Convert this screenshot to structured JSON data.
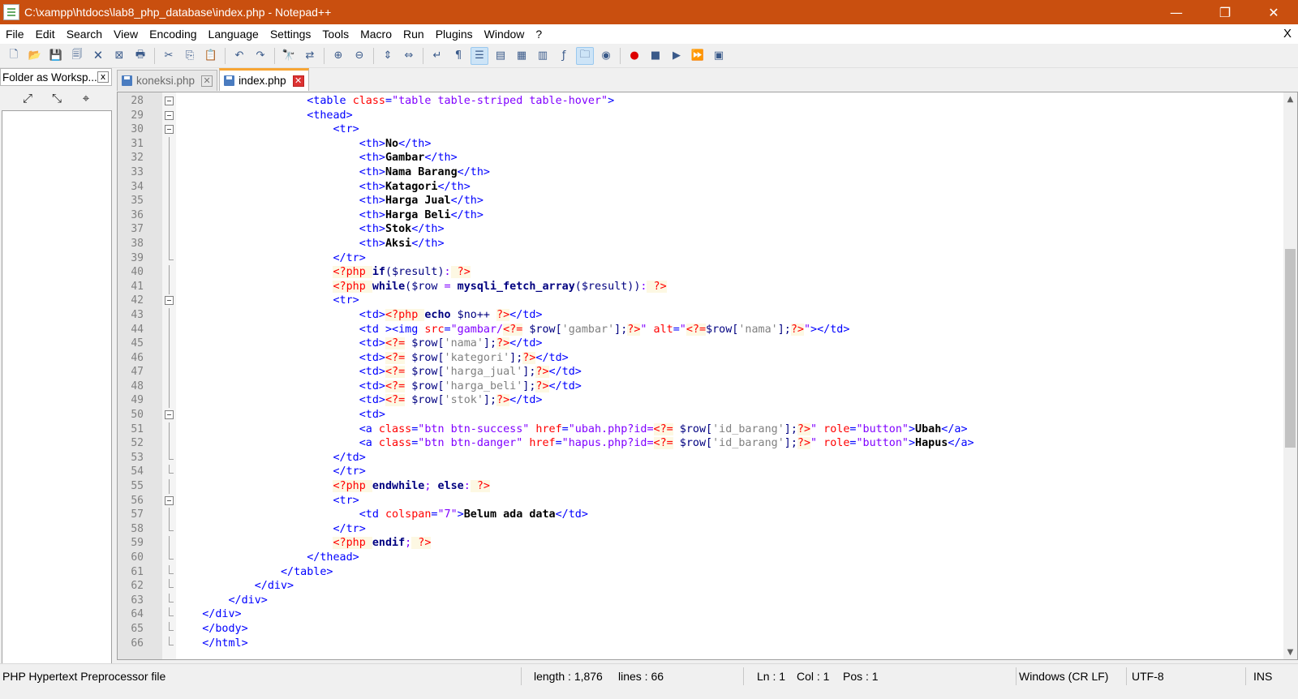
{
  "window": {
    "title": "C:\\xampp\\htdocs\\lab8_php_database\\index.php - Notepad++",
    "minimize": "—",
    "restore": "❐",
    "close": "✕"
  },
  "menu": [
    "File",
    "Edit",
    "Search",
    "View",
    "Encoding",
    "Language",
    "Settings",
    "Tools",
    "Macro",
    "Run",
    "Plugins",
    "Window",
    "?"
  ],
  "menu_close": "X",
  "panel": {
    "title": "Folder as Worksp...",
    "close": "x"
  },
  "tabs": [
    {
      "label": "koneksi.php",
      "close": "✕"
    },
    {
      "label": "index.php",
      "close": "✕"
    }
  ],
  "editor": {
    "lines": [
      {
        "n": "28",
        "fold": "box"
      },
      {
        "n": "29",
        "fold": "box"
      },
      {
        "n": "30",
        "fold": "box"
      },
      {
        "n": "31",
        "fold": "mid"
      },
      {
        "n": "32",
        "fold": "mid"
      },
      {
        "n": "33",
        "fold": "mid"
      },
      {
        "n": "34",
        "fold": "mid"
      },
      {
        "n": "35",
        "fold": "mid"
      },
      {
        "n": "36",
        "fold": "mid"
      },
      {
        "n": "37",
        "fold": "mid"
      },
      {
        "n": "38",
        "fold": "mid"
      },
      {
        "n": "39",
        "fold": "end"
      },
      {
        "n": "40",
        "fold": "mid"
      },
      {
        "n": "41",
        "fold": "mid"
      },
      {
        "n": "42",
        "fold": "box"
      },
      {
        "n": "43",
        "fold": "mid"
      },
      {
        "n": "44",
        "fold": "mid"
      },
      {
        "n": "45",
        "fold": "mid"
      },
      {
        "n": "46",
        "fold": "mid"
      },
      {
        "n": "47",
        "fold": "mid"
      },
      {
        "n": "48",
        "fold": "mid"
      },
      {
        "n": "49",
        "fold": "mid"
      },
      {
        "n": "50",
        "fold": "box"
      },
      {
        "n": "51",
        "fold": "mid"
      },
      {
        "n": "52",
        "fold": "mid"
      },
      {
        "n": "53",
        "fold": "end"
      },
      {
        "n": "54",
        "fold": "end"
      },
      {
        "n": "55",
        "fold": "mid"
      },
      {
        "n": "56",
        "fold": "box"
      },
      {
        "n": "57",
        "fold": "mid"
      },
      {
        "n": "58",
        "fold": "end"
      },
      {
        "n": "59",
        "fold": "mid"
      },
      {
        "n": "60",
        "fold": "end"
      },
      {
        "n": "61",
        "fold": "end"
      },
      {
        "n": "62",
        "fold": "end"
      },
      {
        "n": "63",
        "fold": "end"
      },
      {
        "n": "64",
        "fold": "end"
      },
      {
        "n": "65",
        "fold": "end"
      },
      {
        "n": "66",
        "fold": "end"
      }
    ],
    "code": [
      [
        [
          "",
          "                    "
        ],
        [
          "t",
          "<table "
        ],
        [
          "a",
          "class"
        ],
        [
          "t",
          "="
        ],
        [
          "v",
          "\"table table-striped table-hover\""
        ],
        [
          "t",
          ">"
        ]
      ],
      [
        [
          "",
          "                    "
        ],
        [
          "t",
          "<thead>"
        ]
      ],
      [
        [
          "",
          "                        "
        ],
        [
          "t",
          "<tr>"
        ]
      ],
      [
        [
          "",
          "                            "
        ],
        [
          "t",
          "<th>"
        ],
        [
          "b",
          "No"
        ],
        [
          "t",
          "</th>"
        ]
      ],
      [
        [
          "",
          "                            "
        ],
        [
          "t",
          "<th>"
        ],
        [
          "b",
          "Gambar"
        ],
        [
          "t",
          "</th>"
        ]
      ],
      [
        [
          "",
          "                            "
        ],
        [
          "t",
          "<th>"
        ],
        [
          "b",
          "Nama Barang"
        ],
        [
          "t",
          "</th>"
        ]
      ],
      [
        [
          "",
          "                            "
        ],
        [
          "t",
          "<th>"
        ],
        [
          "b",
          "Katagori"
        ],
        [
          "t",
          "</th>"
        ]
      ],
      [
        [
          "",
          "                            "
        ],
        [
          "t",
          "<th>"
        ],
        [
          "b",
          "Harga Jual"
        ],
        [
          "t",
          "</th>"
        ]
      ],
      [
        [
          "",
          "                            "
        ],
        [
          "t",
          "<th>"
        ],
        [
          "b",
          "Harga Beli"
        ],
        [
          "t",
          "</th>"
        ]
      ],
      [
        [
          "",
          "                            "
        ],
        [
          "t",
          "<th>"
        ],
        [
          "b",
          "Stok"
        ],
        [
          "t",
          "</th>"
        ]
      ],
      [
        [
          "",
          "                            "
        ],
        [
          "t",
          "<th>"
        ],
        [
          "b",
          "Aksi"
        ],
        [
          "t",
          "</th>"
        ]
      ],
      [
        [
          "",
          "                        "
        ],
        [
          "t",
          "</tr>"
        ]
      ],
      [
        [
          "",
          "                        "
        ],
        [
          "php",
          "<?php "
        ],
        [
          "kw",
          "if"
        ],
        [
          "pv",
          "($result)"
        ],
        [
          "op",
          ":"
        ],
        [
          "php",
          " ?>"
        ]
      ],
      [
        [
          "",
          "                        "
        ],
        [
          "php",
          "<?php "
        ],
        [
          "kw",
          "while"
        ],
        [
          "pv",
          "($row "
        ],
        [
          "op",
          "="
        ],
        [
          "pv",
          " "
        ],
        [
          "kw",
          "mysqli_fetch_array"
        ],
        [
          "pv",
          "($result))"
        ],
        [
          "op",
          ":"
        ],
        [
          "php",
          " ?>"
        ]
      ],
      [
        [
          "",
          "                        "
        ],
        [
          "t",
          "<tr>"
        ]
      ],
      [
        [
          "",
          "                            "
        ],
        [
          "t",
          "<td>"
        ],
        [
          "php",
          "<?php "
        ],
        [
          "kw",
          "echo"
        ],
        [
          "pv",
          " $no++ "
        ],
        [
          "php",
          "?>"
        ],
        [
          "t",
          "</td>"
        ]
      ],
      [
        [
          "",
          "                            "
        ],
        [
          "t",
          "<td ><img "
        ],
        [
          "a",
          "src"
        ],
        [
          "t",
          "="
        ],
        [
          "v",
          "\"gambar/"
        ],
        [
          "php",
          "<?="
        ],
        [
          "pv",
          " $row["
        ],
        [
          "str",
          "'gambar'"
        ],
        [
          "pv",
          "];"
        ],
        [
          "php",
          "?>"
        ],
        [
          "v",
          "\""
        ],
        [
          "a",
          " alt"
        ],
        [
          "t",
          "="
        ],
        [
          "v",
          "\""
        ],
        [
          "php",
          "<?="
        ],
        [
          "pv",
          "$row["
        ],
        [
          "str",
          "'nama'"
        ],
        [
          "pv",
          "];"
        ],
        [
          "php",
          "?>"
        ],
        [
          "v",
          "\""
        ],
        [
          "t",
          "></td>"
        ]
      ],
      [
        [
          "",
          "                            "
        ],
        [
          "t",
          "<td>"
        ],
        [
          "php",
          "<?="
        ],
        [
          "pv",
          " $row["
        ],
        [
          "str",
          "'nama'"
        ],
        [
          "pv",
          "];"
        ],
        [
          "php",
          "?>"
        ],
        [
          "t",
          "</td>"
        ]
      ],
      [
        [
          "",
          "                            "
        ],
        [
          "t",
          "<td>"
        ],
        [
          "php",
          "<?="
        ],
        [
          "pv",
          " $row["
        ],
        [
          "str",
          "'kategori'"
        ],
        [
          "pv",
          "];"
        ],
        [
          "php",
          "?>"
        ],
        [
          "t",
          "</td>"
        ]
      ],
      [
        [
          "",
          "                            "
        ],
        [
          "t",
          "<td>"
        ],
        [
          "php",
          "<?="
        ],
        [
          "pv",
          " $row["
        ],
        [
          "str",
          "'harga_jual'"
        ],
        [
          "pv",
          "];"
        ],
        [
          "php",
          "?>"
        ],
        [
          "t",
          "</td>"
        ]
      ],
      [
        [
          "",
          "                            "
        ],
        [
          "t",
          "<td>"
        ],
        [
          "php",
          "<?="
        ],
        [
          "pv",
          " $row["
        ],
        [
          "str",
          "'harga_beli'"
        ],
        [
          "pv",
          "];"
        ],
        [
          "php",
          "?>"
        ],
        [
          "t",
          "</td>"
        ]
      ],
      [
        [
          "",
          "                            "
        ],
        [
          "t",
          "<td>"
        ],
        [
          "php",
          "<?="
        ],
        [
          "pv",
          " $row["
        ],
        [
          "str",
          "'stok'"
        ],
        [
          "pv",
          "];"
        ],
        [
          "php",
          "?>"
        ],
        [
          "t",
          "</td>"
        ]
      ],
      [
        [
          "",
          "                            "
        ],
        [
          "t",
          "<td>"
        ]
      ],
      [
        [
          "",
          "                            "
        ],
        [
          "t",
          "<a "
        ],
        [
          "a",
          "class"
        ],
        [
          "t",
          "="
        ],
        [
          "v",
          "\"btn btn-success\""
        ],
        [
          "a",
          " href"
        ],
        [
          "t",
          "="
        ],
        [
          "v",
          "\"ubah.php?id="
        ],
        [
          "php",
          "<?="
        ],
        [
          "pv",
          " $row["
        ],
        [
          "str",
          "'id_barang'"
        ],
        [
          "pv",
          "];"
        ],
        [
          "php",
          "?>"
        ],
        [
          "v",
          "\""
        ],
        [
          "a",
          " role"
        ],
        [
          "t",
          "="
        ],
        [
          "v",
          "\"button\""
        ],
        [
          "t",
          ">"
        ],
        [
          "b",
          "Ubah"
        ],
        [
          "t",
          "</a>"
        ]
      ],
      [
        [
          "",
          "                            "
        ],
        [
          "t",
          "<a "
        ],
        [
          "a",
          "class"
        ],
        [
          "t",
          "="
        ],
        [
          "v",
          "\"btn btn-danger\""
        ],
        [
          "a",
          " href"
        ],
        [
          "t",
          "="
        ],
        [
          "v",
          "\"hapus.php?id="
        ],
        [
          "php",
          "<?="
        ],
        [
          "pv",
          " $row["
        ],
        [
          "str",
          "'id_barang'"
        ],
        [
          "pv",
          "];"
        ],
        [
          "php",
          "?>"
        ],
        [
          "v",
          "\""
        ],
        [
          "a",
          " role"
        ],
        [
          "t",
          "="
        ],
        [
          "v",
          "\"button\""
        ],
        [
          "t",
          ">"
        ],
        [
          "b",
          "Hapus"
        ],
        [
          "t",
          "</a>"
        ]
      ],
      [
        [
          "",
          "                        "
        ],
        [
          "t",
          "</td>"
        ]
      ],
      [
        [
          "",
          "                        "
        ],
        [
          "t",
          "</tr>"
        ]
      ],
      [
        [
          "",
          "                        "
        ],
        [
          "php",
          "<?php "
        ],
        [
          "kw",
          "endwhile"
        ],
        [
          "op",
          ";"
        ],
        [
          "pv",
          " "
        ],
        [
          "kw",
          "else"
        ],
        [
          "op",
          ":"
        ],
        [
          "php",
          " ?>"
        ]
      ],
      [
        [
          "",
          "                        "
        ],
        [
          "t",
          "<tr>"
        ]
      ],
      [
        [
          "",
          "                            "
        ],
        [
          "t",
          "<td "
        ],
        [
          "a",
          "colspan"
        ],
        [
          "t",
          "="
        ],
        [
          "v",
          "\"7\""
        ],
        [
          "t",
          ">"
        ],
        [
          "b",
          "Belum ada data"
        ],
        [
          "t",
          "</td>"
        ]
      ],
      [
        [
          "",
          "                        "
        ],
        [
          "t",
          "</tr>"
        ]
      ],
      [
        [
          "",
          "                        "
        ],
        [
          "php",
          "<?php "
        ],
        [
          "kw",
          "endif"
        ],
        [
          "op",
          ";"
        ],
        [
          "php",
          " ?>"
        ]
      ],
      [
        [
          "",
          "                    "
        ],
        [
          "t",
          "</thead>"
        ]
      ],
      [
        [
          "",
          "                "
        ],
        [
          "t",
          "</table>"
        ]
      ],
      [
        [
          "",
          "            "
        ],
        [
          "t",
          "</div>"
        ]
      ],
      [
        [
          "",
          "        "
        ],
        [
          "t",
          "</div>"
        ]
      ],
      [
        [
          "",
          "    "
        ],
        [
          "t",
          "</div>"
        ]
      ],
      [
        [
          "",
          "    "
        ],
        [
          "t",
          "</body>"
        ]
      ],
      [
        [
          "",
          "    "
        ],
        [
          "t",
          "</html>"
        ]
      ]
    ]
  },
  "status": {
    "file_type": "PHP Hypertext Preprocessor file",
    "length": "length : 1,876",
    "lines": "lines : 66",
    "ln": "Ln : 1",
    "col": "Col : 1",
    "pos": "Pos : 1",
    "eol": "Windows (CR LF)",
    "encoding": "UTF-8",
    "mode": "INS"
  },
  "toolbar_icons": [
    "new-file-icon",
    "open-file-icon",
    "save-icon",
    "save-all-icon",
    "close-icon",
    "close-all-icon",
    "print-icon",
    "cut-icon",
    "copy-icon",
    "paste-icon",
    "undo-icon",
    "redo-icon",
    "find-icon",
    "replace-icon",
    "zoom-in-icon",
    "zoom-out-icon",
    "sync-vertical-icon",
    "sync-horizontal-icon",
    "word-wrap-icon",
    "show-all-chars-icon",
    "indent-guide-icon",
    "udl-icon",
    "doc-map-icon",
    "doc-list-icon",
    "function-list-icon",
    "folder-workspace-icon",
    "monitor-icon",
    "record-macro-icon",
    "stop-macro-icon",
    "play-macro-icon",
    "run-macro-multiple-icon",
    "save-macro-icon"
  ]
}
